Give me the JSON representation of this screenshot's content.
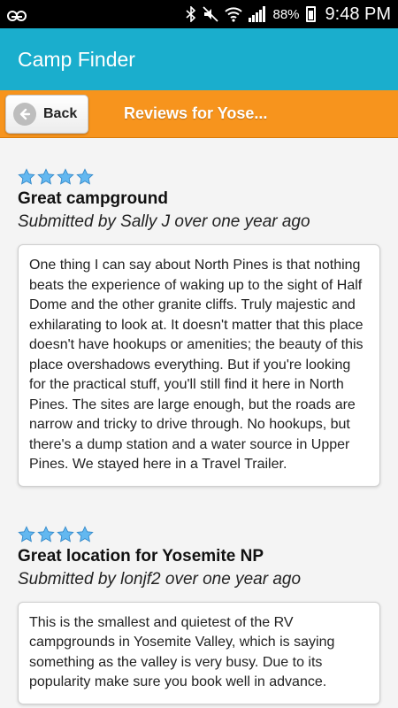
{
  "status_bar": {
    "battery": "88%",
    "time": "9:48 PM"
  },
  "app_bar": {
    "title": "Camp Finder"
  },
  "nav": {
    "back_label": "Back",
    "title": "Reviews for Yose..."
  },
  "colors": {
    "app_bar": "#1aaecd",
    "nav_bar": "#f7941d",
    "star": "#63b8f0"
  },
  "reviews": [
    {
      "rating": 4,
      "title": "Great campground",
      "meta": "Submitted by Sally J over one year ago",
      "body": "One thing I can say about North Pines is that nothing beats the experience of waking up to the sight of Half Dome and the other granite cliffs. Truly majestic and exhilarating to look at. It doesn't matter that this place doesn't have hookups or amenities; the beauty of this place overshadows everything. But if you're looking for the practical stuff, you'll still find it here in North Pines. The sites are large enough, but the roads are narrow and tricky to drive through. No hookups, but there's a dump station and a water source in Upper Pines. We stayed here in a Travel Trailer."
    },
    {
      "rating": 4,
      "title": "Great location for Yosemite NP",
      "meta": "Submitted by lonjf2 over one year ago",
      "body": "This is the smallest and quietest of the RV campgrounds in Yosemite Valley, which is saying something as the valley is very busy. Due to its popularity make sure you book well in advance."
    }
  ]
}
